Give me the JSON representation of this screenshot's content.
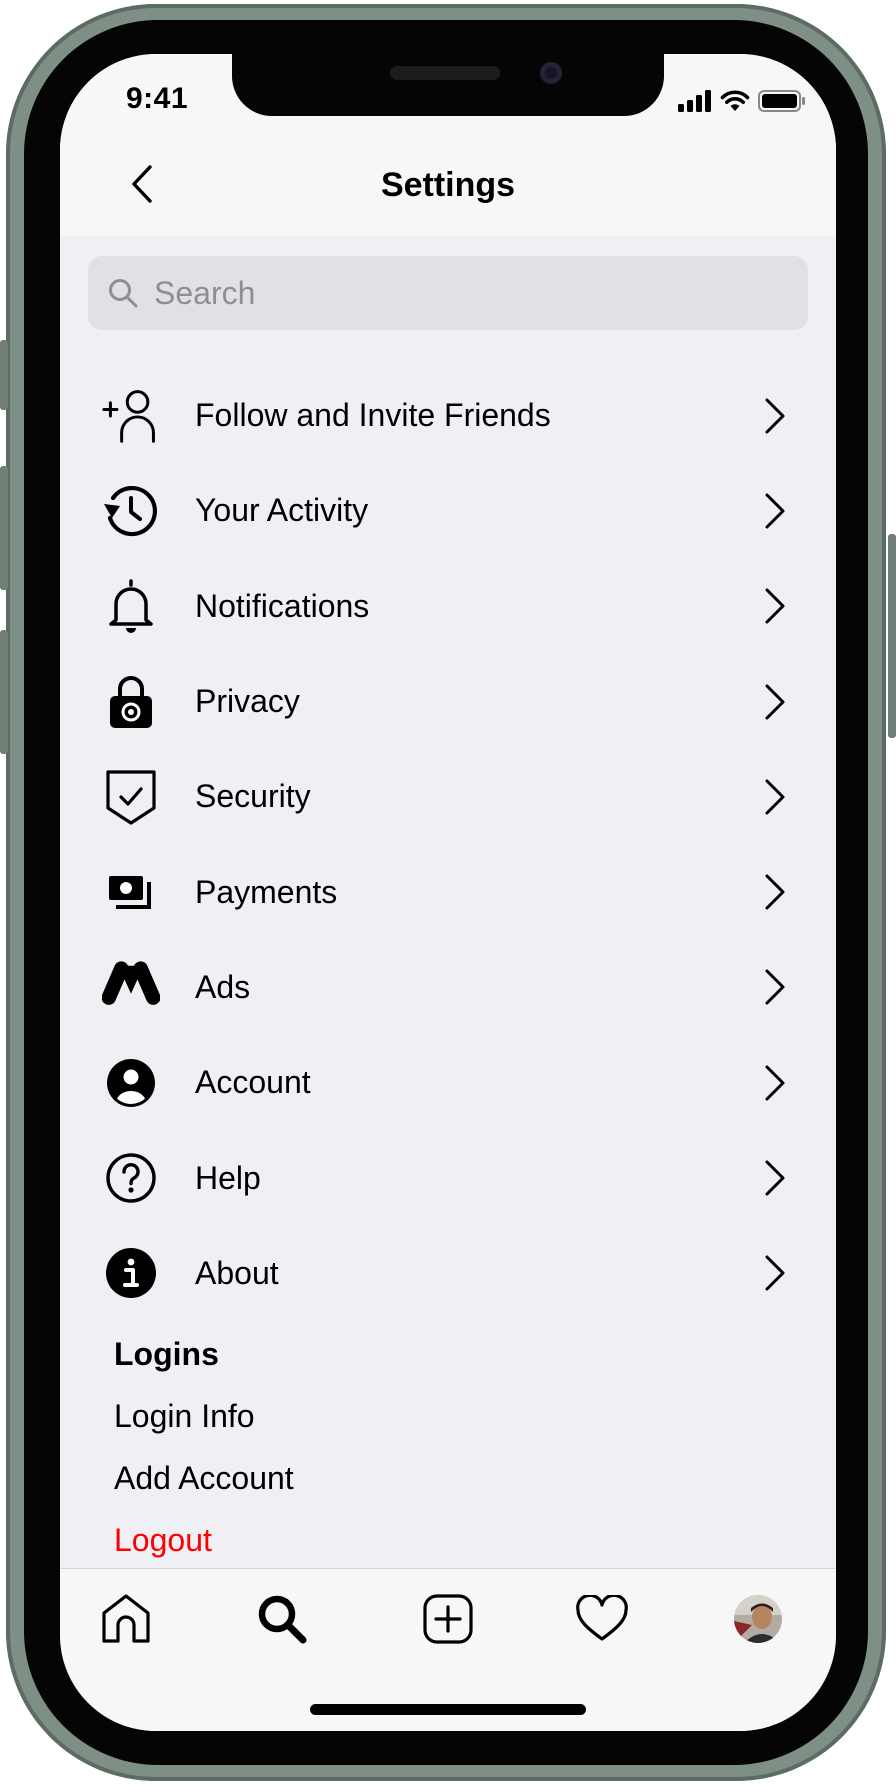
{
  "status_bar": {
    "time": "9:41"
  },
  "header": {
    "title": "Settings"
  },
  "search": {
    "placeholder": "Search"
  },
  "menu": {
    "items": [
      {
        "label": "Follow and Invite Friends",
        "icon": "add-person-icon"
      },
      {
        "label": "Your Activity",
        "icon": "activity-history-icon"
      },
      {
        "label": "Notifications",
        "icon": "bell-icon"
      },
      {
        "label": "Privacy",
        "icon": "lock-icon"
      },
      {
        "label": "Security",
        "icon": "shield-check-icon"
      },
      {
        "label": "Payments",
        "icon": "payments-card-icon"
      },
      {
        "label": "Ads",
        "icon": "ads-icon"
      },
      {
        "label": "Account",
        "icon": "account-icon"
      },
      {
        "label": "Help",
        "icon": "help-icon"
      },
      {
        "label": "About",
        "icon": "info-icon"
      }
    ]
  },
  "logins": {
    "title": "Logins",
    "login_info": "Login Info",
    "add_account": "Add Account",
    "logout": "Logout"
  },
  "colors": {
    "logout": "#ff0000",
    "background": "#f0eff4",
    "header": "#f7f7f8",
    "frame": "#7e8f86"
  },
  "tabbar": {
    "tabs": [
      "home-icon",
      "search-icon",
      "create-post-icon",
      "heart-icon",
      "profile-avatar"
    ]
  }
}
